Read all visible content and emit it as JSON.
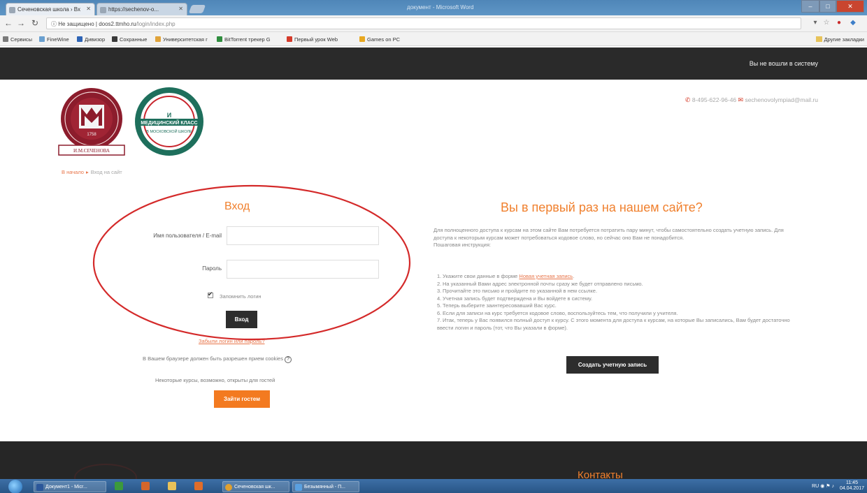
{
  "browser": {
    "tabs": [
      {
        "label": "Сеченовская школа › Вх"
      },
      {
        "label": "https://sechenov-o..."
      }
    ],
    "window_title": "документ - Microsoft Word",
    "address": {
      "security": "Не защищено",
      "domain": "doos2.ttmho.ru",
      "path": "/login/index.php"
    },
    "bookmarks": [
      {
        "label": "Сервисы"
      },
      {
        "label": "FineWine"
      },
      {
        "label": "Дивизор"
      },
      {
        "label": "Сохранные"
      },
      {
        "label": "Университетская г"
      },
      {
        "label": "BitTorrent трекер G"
      },
      {
        "label": "Первый урок Web"
      },
      {
        "label": "Games on PC"
      }
    ],
    "other_bookmarks": "Другие закладки"
  },
  "site": {
    "topbar": {
      "status": "Вы не вошли в систему"
    },
    "contacts": {
      "phone": "8-495-622-96-46",
      "email": "sechenovolympiad@mail.ru"
    },
    "logo1": {
      "text": "И.М.СЕЧЕНОВА",
      "year": "1758"
    },
    "logo2": {
      "title": "МЕДИЦИНСКИЙ КЛАСС",
      "sub": "В МОСКОВСКОЙ ШКОЛЕ"
    },
    "breadcrumb": {
      "home": "В начало",
      "current": "Вход на сайт"
    },
    "login": {
      "heading": "Вход",
      "username_label": "Имя пользователя / E-mail",
      "username_value": "",
      "password_label": "Пароль",
      "password_value": "",
      "remember_label": "Запомнить логин",
      "remember_checked": true,
      "login_button": "Вход",
      "forgot_link": "Забыли логин или пароль?",
      "cookies_note": "В Вашем браузере должен быть разрешен прием cookies",
      "guest_note": "Некоторые курсы, возможно, открыты для гостей",
      "guest_button": "Зайти гостем"
    },
    "signup": {
      "heading": "Вы в первый раз на нашем сайте?",
      "intro": "Для полноценного доступа к курсам на этом сайте Вам потребуется потратить пару минут, чтобы самостоятельно создать учетную запись. Для доступа к некоторым курсам может потребоваться кодовое слово, но сейчас оно Вам не понадобится.",
      "instructions_title": "Пошаговая инструкция:",
      "steps": [
        {
          "n": "1.",
          "pre": "Укажите свои данные в форме ",
          "link": "Новая учетная запись",
          "post": "."
        },
        {
          "n": "2.",
          "pre": "На указанный Вами адрес электронной почты сразу же будет отправлено письмо.",
          "link": "",
          "post": ""
        },
        {
          "n": "3.",
          "pre": "Прочитайте это письмо и пройдите по указанной в нем ссылке.",
          "link": "",
          "post": ""
        },
        {
          "n": "4.",
          "pre": "Учетная запись будет подтверждена и Вы войдете в систему.",
          "link": "",
          "post": ""
        },
        {
          "n": "5.",
          "pre": "Теперь выберите заинтересовавший Вас курс.",
          "link": "",
          "post": ""
        },
        {
          "n": "6.",
          "pre": "Если для записи на курс требуется кодовое слово, воспользуйтесь тем, что получили у учителя.",
          "link": "",
          "post": ""
        },
        {
          "n": "7.",
          "pre": "Итак, теперь у Вас появился полный доступ к курсу. С этого момента для доступа к курсам, на которые Вы записались, Вам будет достаточно ввести логин и пароль (тот, что Вы указали в форме).",
          "link": "",
          "post": ""
        }
      ],
      "create_button": "Создать учетную запись"
    },
    "footer": {
      "contacts_heading": "Контакты"
    }
  },
  "taskbar": {
    "items": [
      {
        "label": "Документ1 - Micr..."
      },
      {
        "label": "Сеченовская шк..."
      },
      {
        "label": "Безымянный - П..."
      }
    ],
    "lang": "RU",
    "time": "11:45",
    "date": "04.04.2017"
  },
  "colors": {
    "accent": "#f0802e",
    "topbar": "#2a2a2a",
    "annotation": "#d42a2a",
    "button_dark": "#2d2d2d"
  }
}
